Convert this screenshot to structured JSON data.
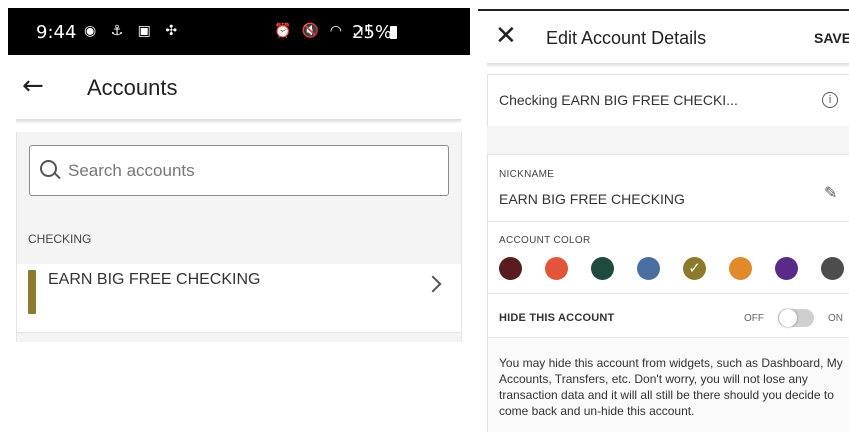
{
  "left": {
    "status": {
      "time": "9:44",
      "battery": "25%",
      "left_icons": "◉ ⚓ ▣ ✣",
      "right_icons": "⏰ 🔇 ◠ .ıl"
    },
    "header": {
      "title": "Accounts",
      "back_icon": "arrow-left-icon"
    },
    "search": {
      "placeholder": "Search accounts",
      "value": ""
    },
    "section": {
      "label": "CHECKING"
    },
    "account": {
      "name": "EARN BIG FREE CHECKING",
      "color": "#8b7a2c"
    }
  },
  "right": {
    "header": {
      "title": "Edit Account Details",
      "save_label": "SAVE",
      "close_icon": "close-icon"
    },
    "account_summary": "Checking EARN BIG FREE CHECKI...",
    "nickname": {
      "label": "NICKNAME",
      "value": "EARN BIG FREE CHECKING"
    },
    "color": {
      "label": "ACCOUNT COLOR",
      "swatches": [
        "#5a1d1f",
        "#e2553a",
        "#1f4a3f",
        "#4a6ea2",
        "#8b7a2c",
        "#e08a2c",
        "#5a2a88",
        "#4d4d4d"
      ],
      "selected_index": 4
    },
    "hide": {
      "label": "HIDE THIS ACCOUNT",
      "off_label": "OFF",
      "on_label": "ON",
      "state": "off"
    },
    "note": "You may hide this account from widgets, such as Dashboard, My Accounts, Transfers, etc. Don't worry, you will not lose any transaction data and it will all still be there should you decide to come back and un-hide this account."
  }
}
